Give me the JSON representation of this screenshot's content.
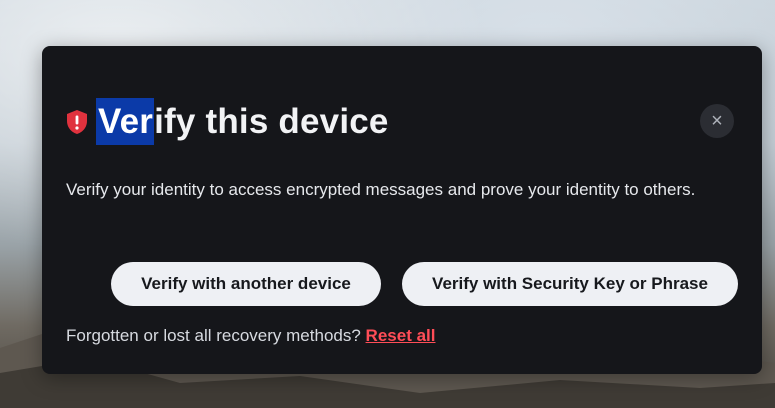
{
  "dialog": {
    "title_highlight": "Ver",
    "title_rest": "ify this device",
    "description": "Verify your identity to access encrypted messages and prove your identity to others.",
    "close_symbol": "×",
    "buttons": {
      "verify_device": "Verify with another device",
      "verify_key": "Verify with Security Key or Phrase"
    },
    "footer_text": "Forgotten or lost all recovery methods?",
    "reset_link": "Reset all"
  },
  "icons": {
    "title_icon": "shield-alert-icon",
    "close_icon": "close-icon"
  },
  "colors": {
    "dialog_bg": "#15161a",
    "shield": "#e0323e",
    "selection": "#0b3aa8",
    "button_bg": "#eef0f4",
    "reset_link": "#ff4d57"
  }
}
